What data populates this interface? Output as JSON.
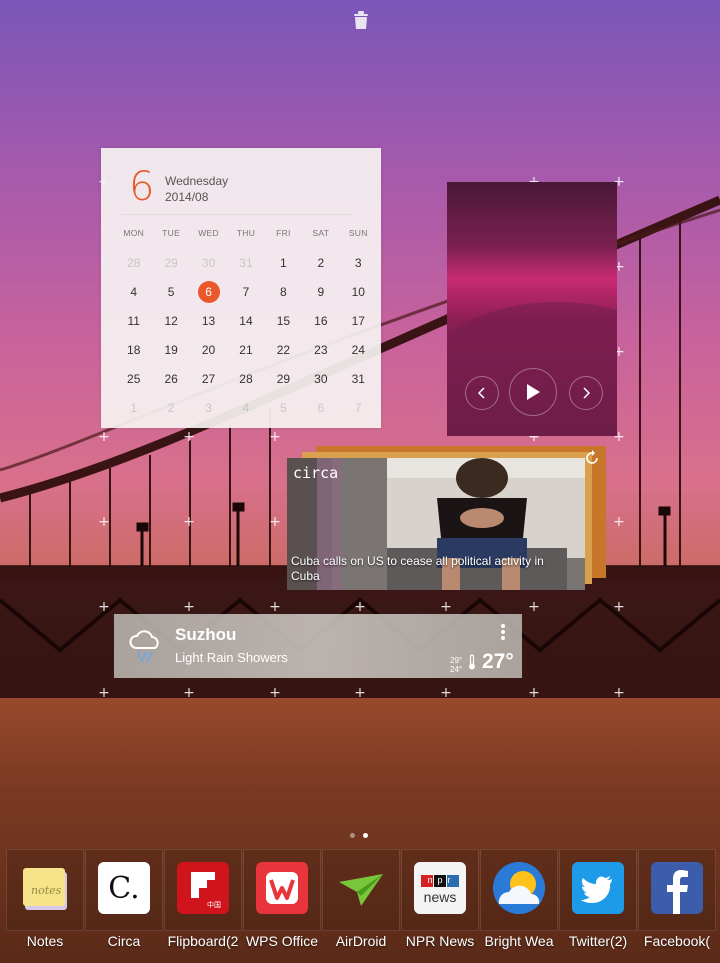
{
  "calendar": {
    "day_number": "6",
    "weekday": "Wednesday",
    "year_month": "2014/08",
    "headers": [
      "MON",
      "TUE",
      "WED",
      "THU",
      "FRI",
      "SAT",
      "SUN"
    ],
    "weeks": [
      [
        [
          "28",
          true
        ],
        [
          "29",
          true
        ],
        [
          "30",
          true
        ],
        [
          "31",
          true
        ],
        [
          "1",
          false
        ],
        [
          "2",
          false
        ],
        [
          "3",
          false
        ]
      ],
      [
        [
          "4",
          false
        ],
        [
          "5",
          false
        ],
        [
          "6",
          false
        ],
        [
          "7",
          false
        ],
        [
          "8",
          false
        ],
        [
          "9",
          false
        ],
        [
          "10",
          false
        ]
      ],
      [
        [
          "11",
          false
        ],
        [
          "12",
          false
        ],
        [
          "13",
          false
        ],
        [
          "14",
          false
        ],
        [
          "15",
          false
        ],
        [
          "16",
          false
        ],
        [
          "17",
          false
        ]
      ],
      [
        [
          "18",
          false
        ],
        [
          "19",
          false
        ],
        [
          "20",
          false
        ],
        [
          "21",
          false
        ],
        [
          "22",
          false
        ],
        [
          "23",
          false
        ],
        [
          "24",
          false
        ]
      ],
      [
        [
          "25",
          false
        ],
        [
          "26",
          false
        ],
        [
          "27",
          false
        ],
        [
          "28",
          false
        ],
        [
          "29",
          false
        ],
        [
          "30",
          false
        ],
        [
          "31",
          false
        ]
      ],
      [
        [
          "1",
          true
        ],
        [
          "2",
          true
        ],
        [
          "3",
          true
        ],
        [
          "4",
          true
        ],
        [
          "5",
          true
        ],
        [
          "6",
          true
        ],
        [
          "7",
          true
        ]
      ]
    ],
    "today": "6",
    "accent_color": "#e8582a"
  },
  "music": {
    "prev_icon": "chevron-left-icon",
    "play_icon": "play-icon",
    "next_icon": "chevron-right-icon"
  },
  "news": {
    "source": "circa",
    "headline": "Cuba calls on US to cease all political activity in Cuba"
  },
  "weather": {
    "city": "Suzhou",
    "condition": "Light Rain Showers",
    "high": "29°",
    "low": "24°",
    "temp": "27°"
  },
  "page_indicator": {
    "total": 2,
    "active": 2
  },
  "dock": [
    {
      "label": "Notes",
      "icon": "notes-icon"
    },
    {
      "label": "Circa",
      "icon": "circa-icon"
    },
    {
      "label": "Flipboard(2",
      "icon": "flipboard-icon",
      "icon_text": "中国"
    },
    {
      "label": "WPS Office",
      "icon": "wps-office-icon"
    },
    {
      "label": "AirDroid",
      "icon": "airdroid-icon"
    },
    {
      "label": "NPR News",
      "icon": "npr-news-icon",
      "icon_text_top": "npr",
      "icon_text_bottom": "news"
    },
    {
      "label": "Bright Wea",
      "icon": "bright-weather-icon"
    },
    {
      "label": "Twitter(2)",
      "icon": "twitter-icon"
    },
    {
      "label": "Facebook(",
      "icon": "facebook-icon"
    }
  ]
}
